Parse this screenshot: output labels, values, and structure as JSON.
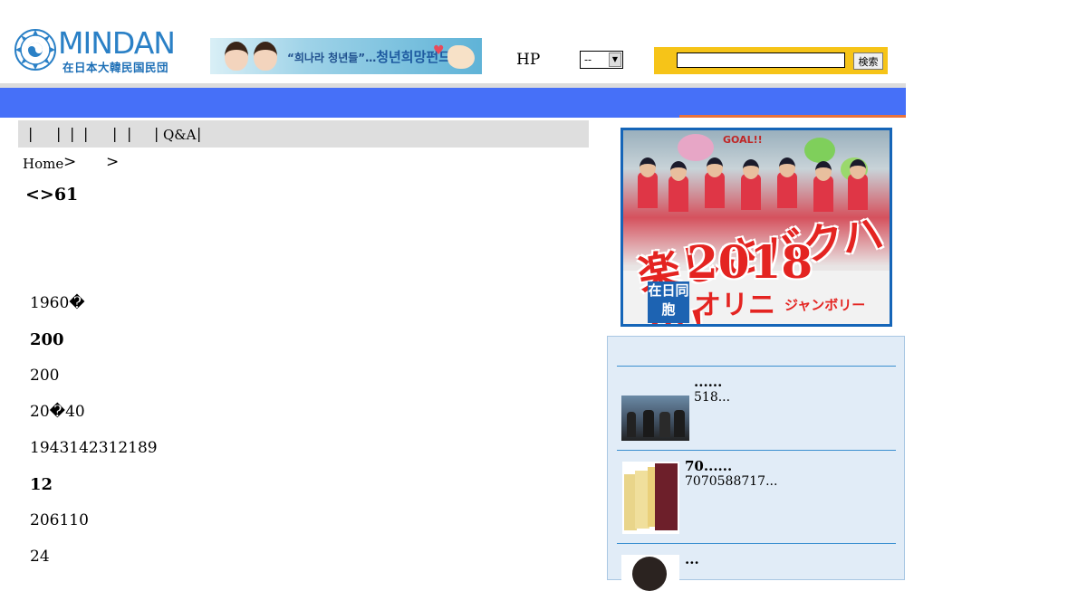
{
  "header": {
    "logo": {
      "brand": "MINDAN",
      "subbrand": "在日本大韓民国民団"
    },
    "banner": {
      "text_prefix": "“희나라 청년들”…",
      "text_main": "청년희망펀드"
    },
    "hp_label": "HP",
    "select": {
      "selected": "--"
    },
    "search": {
      "value": "",
      "button_label": "検索"
    }
  },
  "menu": {
    "separators": [
      "|",
      "|",
      "|",
      "|",
      "|",
      "|",
      "|"
    ],
    "qa_label": "Q&A"
  },
  "breadcrumb": {
    "home": "Home",
    "sep1": ">",
    "sep2": ">"
  },
  "article": {
    "title": "<>61",
    "paragraphs": [
      {
        "text": "1960�",
        "bold": false
      },
      {
        "text": "200",
        "bold": true
      },
      {
        "text": "200",
        "bold": false
      },
      {
        "text": "20�40",
        "bold": false
      },
      {
        "text": "1943142312189",
        "bold": false
      },
      {
        "text": "12",
        "bold": true
      },
      {
        "text": "206110",
        "bold": false
      },
      {
        "text": "24",
        "bold": false
      }
    ]
  },
  "sidebar": {
    "promo": {
      "headline": "楽しさバクハツ!",
      "year": "2018",
      "tag": "在日同胞",
      "name": "オリニ",
      "event": "ジャンボリー",
      "sign": "GOAL!!"
    },
    "news": [
      {
        "title": "......",
        "desc": "518..."
      },
      {
        "title": "70......",
        "desc": "7070588717..."
      },
      {
        "title": "...",
        "desc": ""
      }
    ]
  },
  "colors": {
    "blue_bar": "#4670f8",
    "orange_accent": "#e8723c",
    "search_bg": "#f6c418",
    "news_bg": "#e1ecf7",
    "brand_blue": "#2a80c6"
  }
}
